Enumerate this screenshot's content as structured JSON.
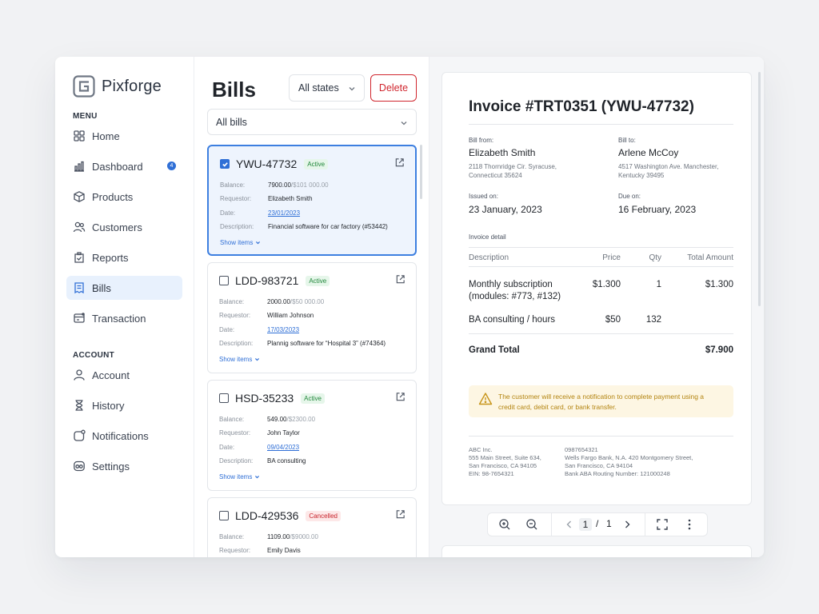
{
  "brand": {
    "name": "Pixforge"
  },
  "sidebar": {
    "menu_label": "MENU",
    "menu": [
      {
        "label": "Home",
        "icon": "grid-icon"
      },
      {
        "label": "Dashboard",
        "icon": "bar-chart-icon",
        "badge": "4"
      },
      {
        "label": "Products",
        "icon": "box-icon"
      },
      {
        "label": "Customers",
        "icon": "users-icon"
      },
      {
        "label": "Reports",
        "icon": "report-icon"
      },
      {
        "label": "Bills",
        "icon": "bill-icon",
        "active": true
      },
      {
        "label": "Transaction",
        "icon": "transaction-icon"
      }
    ],
    "account_label": "ACCOUNT",
    "account": [
      {
        "label": "Account",
        "icon": "user-icon"
      },
      {
        "label": "History",
        "icon": "hourglass-icon"
      },
      {
        "label": "Notifications",
        "icon": "bell-icon"
      },
      {
        "label": "Settings",
        "icon": "settings-icon"
      }
    ]
  },
  "bills": {
    "title": "Bills",
    "states_filter": "All states",
    "delete_label": "Delete",
    "bills_filter": "All bills",
    "field_labels": {
      "balance": "Balance:",
      "requestor": "Requestor:",
      "date": "Date:",
      "description": "Description:"
    },
    "show_items": "Show items",
    "items": [
      {
        "id": "YWU-47732",
        "status": "Active",
        "checked": true,
        "balance": "7900.00",
        "total": "/$101 000.00",
        "requestor": "Elizabeth Smith",
        "date": "23/01/2023",
        "description": "Financial software for car factory (#53442)"
      },
      {
        "id": "LDD-983721",
        "status": "Active",
        "checked": false,
        "balance": "2000.00",
        "total": "/$50 000.00",
        "requestor": "William Johnson",
        "date": "17/03/2023",
        "description": "Plannig software for “Hospital 3”  (#74364)"
      },
      {
        "id": "HSD-35233",
        "status": "Active",
        "checked": false,
        "balance": "549.00",
        "total": "/$2300.00",
        "requestor": "John Taylor",
        "date": "09/04/2023",
        "description": "BA consulting"
      },
      {
        "id": "LDD-429536",
        "status": "Cancelled",
        "checked": false,
        "balance": "1109.00",
        "total": "/$9000.00",
        "requestor": "Emily Davis"
      }
    ]
  },
  "invoice": {
    "title": "Invoice #TRT0351 (YWU-47732)",
    "bill_from_label": "Bill from:",
    "bill_from_name": "Elizabeth Smith",
    "bill_from_address": "2118 Thornridge Cir. Syracuse, Connecticut 35624",
    "bill_to_label": "Bill to:",
    "bill_to_name": "Arlene McCoy",
    "bill_to_address": "4517 Washington Ave. Manchester, Kentucky 39495",
    "issued_label": "Issued on:",
    "issued_value": "23 January, 2023",
    "due_label": "Due on:",
    "due_value": "16 February, 2023",
    "detail_label": "Invoice detail",
    "columns": {
      "description": "Description",
      "price": "Price",
      "qty": "Qty",
      "total": "Total Amount"
    },
    "rows": [
      {
        "description": "Monthly subscription (modules: #773, #132)",
        "price": "$1.300",
        "qty": "1",
        "total": "$1.300"
      },
      {
        "description": "BA consulting / hours",
        "price": "$50",
        "qty": "132",
        "total": ""
      }
    ],
    "grand_total_label": "Grand Total",
    "grand_total_value": "$7.900",
    "notice": "The customer will receive a notification to complete payment using a credit card, debit card, or bank transfer.",
    "footer_left": [
      "ABC Inc.",
      "555 Main Street, Suite 634,",
      "San Francisco, CA 94105",
      "EIN: 98-7654321"
    ],
    "footer_right": [
      "0987654321",
      "Wells Fargo Bank, N.A. 420 Montgomery Street,",
      "San Francisco, CA 94104",
      "Bank ABA Routing Number: 121000248"
    ]
  },
  "viewer": {
    "current_page": "1",
    "separator": "/",
    "total_pages": "1"
  },
  "colors": {
    "accent": "#2f6fd6",
    "danger": "#d0262e",
    "active_bg": "#e8f1fd",
    "notice_bg": "#fdf6e3",
    "notice_text": "#b38410"
  }
}
